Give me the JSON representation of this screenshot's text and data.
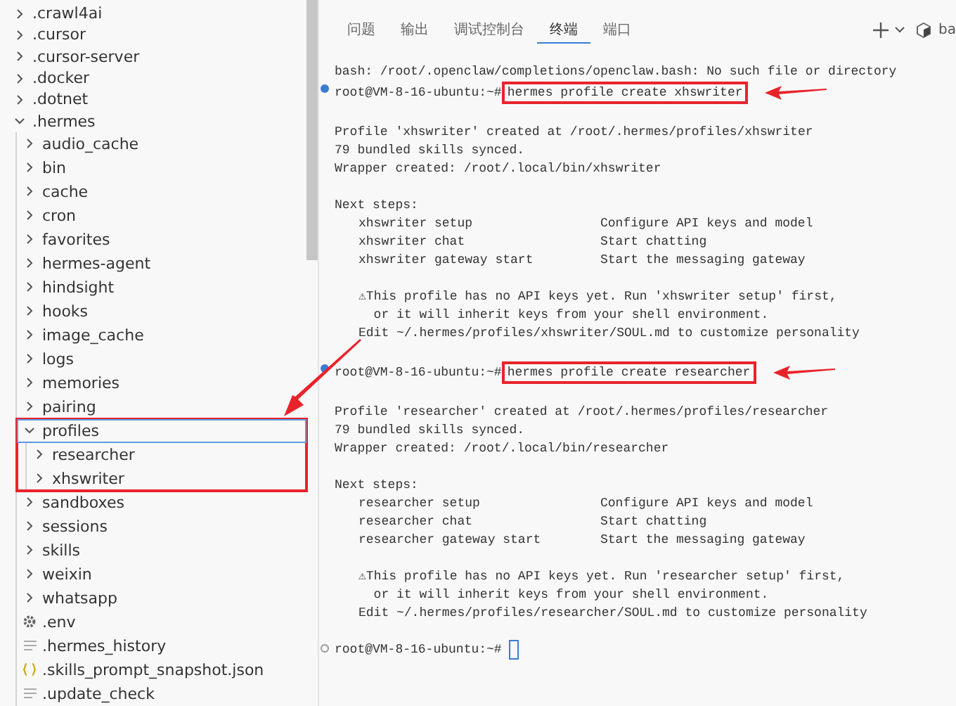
{
  "explorer": {
    "items": [
      {
        "label": ".crawl4ai",
        "kind": "folder",
        "expanded": false,
        "selected": false,
        "annotated": false
      },
      {
        "label": ".cursor",
        "kind": "folder",
        "expanded": false,
        "selected": false,
        "annotated": false
      },
      {
        "label": ".cursor-server",
        "kind": "folder",
        "expanded": false,
        "selected": false,
        "annotated": false
      },
      {
        "label": ".docker",
        "kind": "folder",
        "expanded": false,
        "selected": false,
        "annotated": false
      },
      {
        "label": ".dotnet",
        "kind": "folder",
        "expanded": false,
        "selected": false,
        "annotated": false
      },
      {
        "label": ".hermes",
        "kind": "folder",
        "expanded": true,
        "selected": false,
        "annotated": false,
        "children": [
          {
            "label": "audio_cache",
            "kind": "folder",
            "expanded": false,
            "selected": false,
            "annotated": false
          },
          {
            "label": "bin",
            "kind": "folder",
            "expanded": false,
            "selected": false,
            "annotated": false
          },
          {
            "label": "cache",
            "kind": "folder",
            "expanded": false,
            "selected": false,
            "annotated": false
          },
          {
            "label": "cron",
            "kind": "folder",
            "expanded": false,
            "selected": false,
            "annotated": false
          },
          {
            "label": "favorites",
            "kind": "folder",
            "expanded": false,
            "selected": false,
            "annotated": false
          },
          {
            "label": "hermes-agent",
            "kind": "folder",
            "expanded": false,
            "selected": false,
            "annotated": false
          },
          {
            "label": "hindsight",
            "kind": "folder",
            "expanded": false,
            "selected": false,
            "annotated": false
          },
          {
            "label": "hooks",
            "kind": "folder",
            "expanded": false,
            "selected": false,
            "annotated": false
          },
          {
            "label": "image_cache",
            "kind": "folder",
            "expanded": false,
            "selected": false,
            "annotated": false
          },
          {
            "label": "logs",
            "kind": "folder",
            "expanded": false,
            "selected": false,
            "annotated": false
          },
          {
            "label": "memories",
            "kind": "folder",
            "expanded": false,
            "selected": false,
            "annotated": false
          },
          {
            "label": "pairing",
            "kind": "folder",
            "expanded": false,
            "selected": false,
            "annotated": false
          },
          {
            "label": "profiles",
            "kind": "folder",
            "expanded": true,
            "selected": true,
            "annotated": true,
            "children": [
              {
                "label": "researcher",
                "kind": "folder",
                "expanded": false,
                "selected": false,
                "annotated": false
              },
              {
                "label": "xhswriter",
                "kind": "folder",
                "expanded": false,
                "selected": false,
                "annotated": false
              }
            ]
          },
          {
            "label": "sandboxes",
            "kind": "folder",
            "expanded": false,
            "selected": false,
            "annotated": false
          },
          {
            "label": "sessions",
            "kind": "folder",
            "expanded": false,
            "selected": false,
            "annotated": false
          },
          {
            "label": "skills",
            "kind": "folder",
            "expanded": false,
            "selected": false,
            "annotated": false
          },
          {
            "label": "weixin",
            "kind": "folder",
            "expanded": false,
            "selected": false,
            "annotated": false
          },
          {
            "label": "whatsapp",
            "kind": "folder",
            "expanded": false,
            "selected": false,
            "annotated": false
          },
          {
            "label": ".env",
            "kind": "settings",
            "selected": false,
            "annotated": false
          },
          {
            "label": ".hermes_history",
            "kind": "text",
            "selected": false,
            "annotated": false
          },
          {
            "label": ".skills_prompt_snapshot.json",
            "kind": "json",
            "selected": false,
            "annotated": false
          },
          {
            "label": ".update_check",
            "kind": "text",
            "selected": false,
            "annotated": false
          }
        ]
      }
    ]
  },
  "panel": {
    "tabs": [
      {
        "label": "问题",
        "selected": false
      },
      {
        "label": "输出",
        "selected": false
      },
      {
        "label": "调试控制台",
        "selected": false
      },
      {
        "label": "终端",
        "selected": true
      },
      {
        "label": "端口",
        "selected": false
      }
    ],
    "shell_label": "ba",
    "terminal": [
      {
        "kind": "output",
        "text": "bash: /root/.openclaw/completions/openclaw.bash: No such file or directory"
      },
      {
        "kind": "prompt",
        "prompt": "root@VM-8-16-ubuntu:~#",
        "command": "hermes profile create xhswriter",
        "done": true,
        "annotated": true
      },
      {
        "kind": "blank"
      },
      {
        "kind": "output",
        "text": "Profile 'xhswriter' created at /root/.hermes/profiles/xhswriter"
      },
      {
        "kind": "output",
        "text": "79 bundled skills synced."
      },
      {
        "kind": "output",
        "text": "Wrapper created: /root/.local/bin/xhswriter"
      },
      {
        "kind": "blank"
      },
      {
        "kind": "output",
        "text": "Next steps:"
      },
      {
        "kind": "step",
        "command": "xhswriter setup",
        "description": "Configure API keys and model"
      },
      {
        "kind": "step",
        "command": "xhswriter chat",
        "description": "Start chatting"
      },
      {
        "kind": "step",
        "command": "xhswriter gateway start",
        "description": "Start the messaging gateway"
      },
      {
        "kind": "blank"
      },
      {
        "kind": "note",
        "text": "⚠This profile has no API keys yet. Run 'xhswriter setup' first,"
      },
      {
        "kind": "note",
        "text": "  or it will inherit keys from your shell environment."
      },
      {
        "kind": "note",
        "text": "Edit ~/.hermes/profiles/xhswriter/SOUL.md to customize personality"
      },
      {
        "kind": "blank"
      },
      {
        "kind": "prompt",
        "prompt": "root@VM-8-16-ubuntu:~#",
        "command": "hermes profile create researcher",
        "done": true,
        "annotated": true
      },
      {
        "kind": "blank"
      },
      {
        "kind": "output",
        "text": "Profile 'researcher' created at /root/.hermes/profiles/researcher"
      },
      {
        "kind": "output",
        "text": "79 bundled skills synced."
      },
      {
        "kind": "output",
        "text": "Wrapper created: /root/.local/bin/researcher"
      },
      {
        "kind": "blank"
      },
      {
        "kind": "output",
        "text": "Next steps:"
      },
      {
        "kind": "step",
        "command": "researcher setup",
        "description": "Configure API keys and model"
      },
      {
        "kind": "step",
        "command": "researcher chat",
        "description": "Start chatting"
      },
      {
        "kind": "step",
        "command": "researcher gateway start",
        "description": "Start the messaging gateway"
      },
      {
        "kind": "blank"
      },
      {
        "kind": "note",
        "text": "⚠This profile has no API keys yet. Run 'researcher setup' first,"
      },
      {
        "kind": "note",
        "text": "  or it will inherit keys from your shell environment."
      },
      {
        "kind": "note",
        "text": "Edit ~/.hermes/profiles/researcher/SOUL.md to customize personality"
      },
      {
        "kind": "blank"
      },
      {
        "kind": "prompt",
        "prompt": "root@VM-8-16-ubuntu:~#",
        "done": false
      }
    ]
  }
}
